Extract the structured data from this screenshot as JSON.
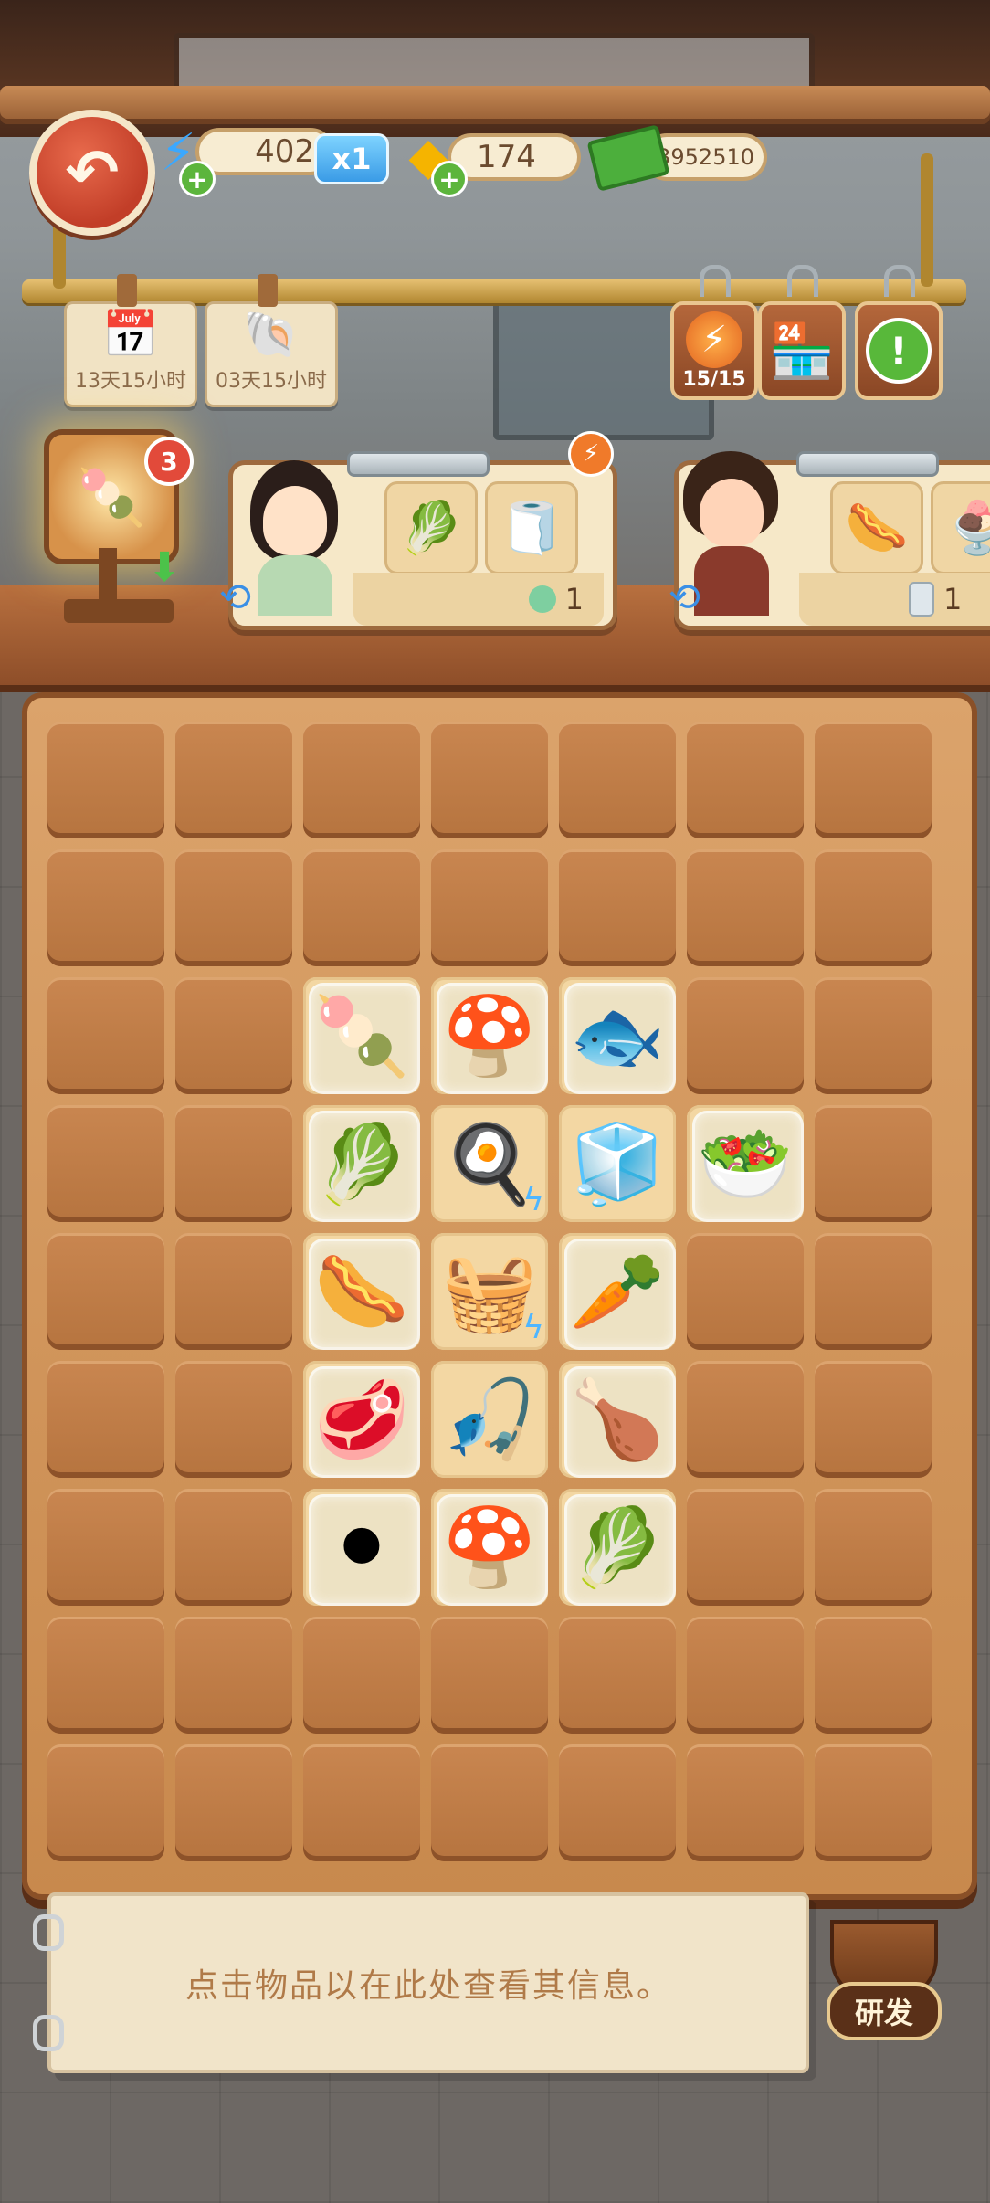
{
  "resources": {
    "energy_value": "402",
    "energy_multiplier": "x1",
    "gems_value": "174",
    "cash_value": "13952510",
    "energy_icon": "lightning-icon",
    "gems_icon": "gem-icon",
    "cash_icon": "cash-icon"
  },
  "events": [
    {
      "timer": "13天15小时",
      "icon": "calendar-icon"
    },
    {
      "timer": "03天15小时",
      "icon": "shell-icon"
    }
  ],
  "tags": {
    "energy_counter": "15/15"
  },
  "orders_board": {
    "badge_count": "3",
    "icon": "popsicle-mold-icon"
  },
  "orders": [
    {
      "customer": "female-chef-avatar",
      "items": [
        "🥬",
        "🧻"
      ],
      "reward_icon": "bulb-icon",
      "reward_count": "1"
    },
    {
      "customer": "grandma-avatar",
      "items": [
        "🌭",
        "🍨"
      ],
      "reward_icon": "jar-icon",
      "reward_count": "1"
    }
  ],
  "board": {
    "columns": 7,
    "rows": 9,
    "items": [
      {
        "col": 2,
        "row": 2,
        "glyph": "🍡",
        "name": "popsicle-item",
        "glass": true
      },
      {
        "col": 3,
        "row": 2,
        "glyph": "🍄",
        "name": "shiitake-mushroom-item",
        "glass": true
      },
      {
        "col": 4,
        "row": 2,
        "glyph": "🐟",
        "name": "fish-item",
        "glass": true
      },
      {
        "col": 2,
        "row": 3,
        "glyph": "🥬",
        "name": "cabbage-vegetables-item",
        "glass": true
      },
      {
        "col": 3,
        "row": 3,
        "glyph": "🍳",
        "name": "cooking-tray-generator",
        "glass": false,
        "bolt": true
      },
      {
        "col": 4,
        "row": 3,
        "glyph": "🧊",
        "name": "popsicle-mold-item",
        "glass": false
      },
      {
        "col": 5,
        "row": 3,
        "glyph": "🥗",
        "name": "vegetable-bowl-item",
        "glass": true
      },
      {
        "col": 2,
        "row": 4,
        "glyph": "🌭",
        "name": "sausage-board-item",
        "glass": true
      },
      {
        "col": 3,
        "row": 4,
        "glyph": "🧺",
        "name": "vegetable-basket-generator",
        "glass": false,
        "bolt": true
      },
      {
        "col": 4,
        "row": 4,
        "glyph": "🥕",
        "name": "vegetable-bag-item",
        "glass": true
      },
      {
        "col": 2,
        "row": 5,
        "glyph": "🥩",
        "name": "raw-meat-item",
        "glass": true
      },
      {
        "col": 3,
        "row": 5,
        "glyph": "🎣",
        "name": "fishing-rod-generator",
        "glass": false
      },
      {
        "col": 4,
        "row": 5,
        "glyph": "🍗",
        "name": "chicken-breast-item",
        "glass": true
      },
      {
        "col": 2,
        "row": 6,
        "glyph": "⚫",
        "name": "pepper-bowl-item",
        "glass": true
      },
      {
        "col": 3,
        "row": 6,
        "glyph": "🍄",
        "name": "mixed-mushrooms-item",
        "glass": true
      },
      {
        "col": 4,
        "row": 6,
        "glyph": "🥬",
        "name": "lettuce-bowl-item",
        "glass": true
      }
    ],
    "active_cells": [
      [
        2,
        2
      ],
      [
        3,
        2
      ],
      [
        4,
        2
      ],
      [
        2,
        3
      ],
      [
        3,
        3
      ],
      [
        4,
        3
      ],
      [
        5,
        3
      ],
      [
        2,
        4
      ],
      [
        3,
        4
      ],
      [
        4,
        4
      ],
      [
        2,
        5
      ],
      [
        3,
        5
      ],
      [
        4,
        5
      ],
      [
        2,
        6
      ],
      [
        3,
        6
      ],
      [
        4,
        6
      ]
    ]
  },
  "info_panel": {
    "hint": "点击物品以在此处查看其信息。"
  },
  "research": {
    "label": "研发"
  }
}
